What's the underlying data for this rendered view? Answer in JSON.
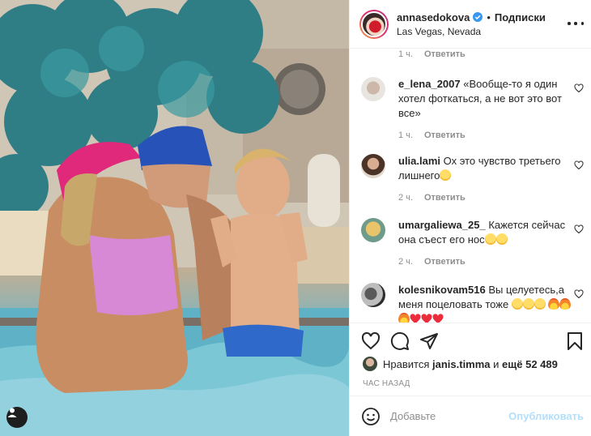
{
  "post": {
    "username": "annasedokova",
    "follow_label": "Подписки",
    "location": "Las Vegas, Nevada"
  },
  "comments_top_meta": {
    "time": "1 ч.",
    "reply": "Ответить"
  },
  "comments": [
    {
      "user": "e_lena_2007",
      "text": "«Вообще-то я один хотел фоткаться, а не вот это вот все»",
      "time": "1 ч.",
      "reply": "Ответить"
    },
    {
      "user": "ulia.lami",
      "text": "Ох это чувство третьего лишнего",
      "time": "2 ч.",
      "reply": "Ответить"
    },
    {
      "user": "umargaliewa_25_",
      "text": "Кажется сейчас она съест его нос",
      "time": "2 ч.",
      "reply": "Ответить"
    },
    {
      "user": "kolesnikovam516",
      "text": "Вы целуетесь,а меня поцеловать тоже"
    }
  ],
  "likes": {
    "prefix": "Нравится",
    "user": "janis.timma",
    "middle": "и",
    "rest": "ещё 52 489"
  },
  "post_time": "ЧАС НАЗАД",
  "add_comment": {
    "placeholder": "Добавьте",
    "publish_label": "Опубликовать"
  },
  "colors": {
    "accent_blue": "#0095f6",
    "publish_disabled": "#b2dffc",
    "like_red": "#ed4956",
    "muted": "#8e8e8e"
  },
  "icons": [
    "verified-icon",
    "more-options-icon",
    "heart-icon",
    "comment-icon",
    "share-icon",
    "bookmark-icon",
    "smiley-icon",
    "tagged-user-icon",
    "emoji-icons"
  ]
}
